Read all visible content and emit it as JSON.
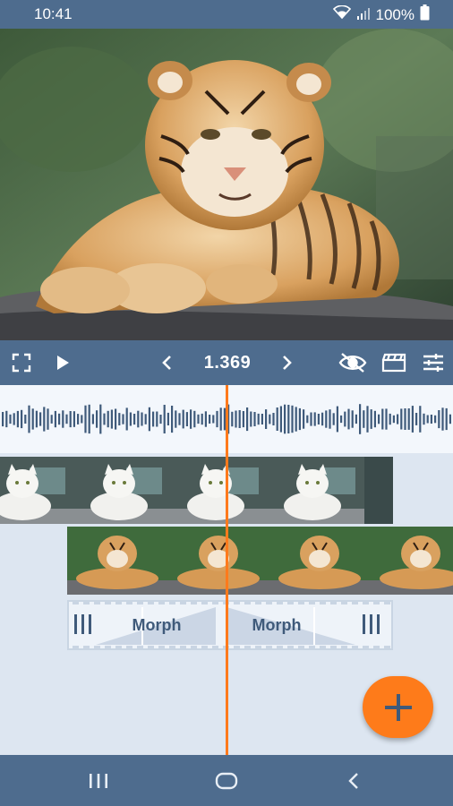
{
  "status_bar": {
    "time": "10:41",
    "battery_text": "100%"
  },
  "toolbar": {
    "time_value": "1.369"
  },
  "timeline": {
    "transitions": [
      {
        "label": "Morph"
      },
      {
        "label": "Morph"
      }
    ],
    "playhead_color": "#ff7a1c"
  },
  "colors": {
    "accent": "#fe7b1a",
    "bar": "#4e6c8e",
    "timeline_bg": "#dde6f1"
  },
  "icons": {
    "toolbar_left": [
      "fullscreen-icon",
      "play-icon"
    ],
    "toolbar_right": [
      "visibility-off-icon",
      "clapperboard-icon",
      "tune-icon"
    ],
    "nav": [
      "recent-apps-icon",
      "home-icon",
      "back-icon"
    ]
  }
}
